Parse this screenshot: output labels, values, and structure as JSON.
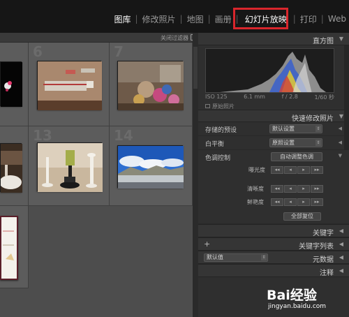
{
  "top_nav": {
    "modules": [
      "图库",
      "修改照片",
      "地图",
      "画册",
      "幻灯片放映",
      "打印",
      "Web"
    ],
    "active": "图库",
    "highlighted": "幻灯片放映"
  },
  "grid_header": {
    "filter_label": "关闭过滤器"
  },
  "grid": {
    "cell_numbers": [
      "6",
      "7",
      "13",
      "14"
    ]
  },
  "panel": {
    "histogram": {
      "title": "直方图",
      "iso": "ISO 125",
      "focal": "6.1 mm",
      "aperture": "f / 2.8",
      "shutter": "1/60 秒",
      "original_label": "原始照片"
    },
    "quick_develop": {
      "title": "快速修改照片",
      "saved_preset_label": "存储的预设",
      "saved_preset_value": "默认设置",
      "white_balance_label": "白平衡",
      "white_balance_value": "原照设置",
      "tone_label": "色调控制",
      "auto_tone_button": "自动调整色调",
      "exposure_label": "曝光度",
      "clarity_label": "清晰度",
      "vibrance_label": "鲜艳度",
      "reset_button": "全部复位"
    },
    "keywording_title": "关键字",
    "keyword_list_title": "关键字列表",
    "keyword_list_plus": "+",
    "metadata_title": "元数据",
    "metadata_preset": "默认值",
    "comments_title": "注释"
  },
  "watermark": {
    "logo": "Bai经验",
    "url": "jingyan.baidu.com"
  },
  "colors": {
    "highlight_border": "#d9262c",
    "active_module": "#ffffff"
  }
}
